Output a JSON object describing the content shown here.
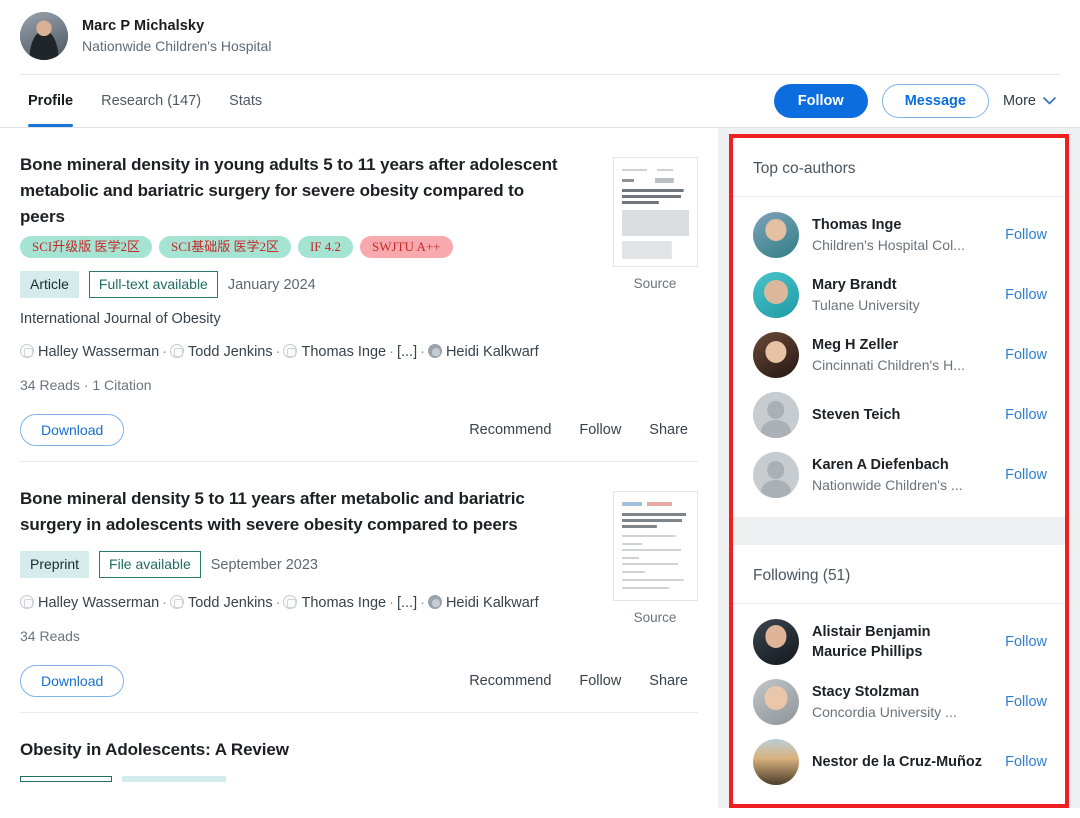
{
  "profile": {
    "name": "Marc P Michalsky",
    "affiliation": "Nationwide Children's Hospital",
    "avatar_icon": "user-photo"
  },
  "nav": {
    "tabs": [
      {
        "label": "Profile",
        "active": true
      },
      {
        "label": "Research (147)",
        "active": false
      },
      {
        "label": "Stats",
        "active": false
      }
    ],
    "follow_label": "Follow",
    "message_label": "Message",
    "more_label": "More",
    "more_icon": "chevron-down-icon"
  },
  "publications": [
    {
      "title": "Bone mineral density in young adults 5 to 11 years after adolescent metabolic and bariatric surgery for severe obesity compared to peers",
      "sci_badges": [
        {
          "text": "SCI升级版 医学2区",
          "style": "mint"
        },
        {
          "text": "SCI基础版 医学2区",
          "style": "mint"
        },
        {
          "text": "IF 4.2",
          "style": "mint"
        },
        {
          "text": "SWJTU A++",
          "style": "pink"
        }
      ],
      "type": "Article",
      "availability": "Full-text available",
      "date": "January 2024",
      "journal": "International Journal of Obesity",
      "authors": [
        "Halley Wasserman",
        "Todd Jenkins",
        "Thomas Inge",
        "[...]",
        "Heidi Kalkwarf"
      ],
      "stats": "34 Reads · 1 Citation",
      "download_label": "Download",
      "actions": [
        "Recommend",
        "Follow",
        "Share"
      ],
      "thumb_label": "Source"
    },
    {
      "title": "Bone mineral density 5 to 11 years after metabolic and bariatric surgery in adolescents with severe obesity compared to peers",
      "sci_badges": [],
      "type": "Preprint",
      "availability": "File available",
      "date": "September 2023",
      "journal": "",
      "authors": [
        "Halley Wasserman",
        "Todd Jenkins",
        "Thomas Inge",
        "[...]",
        "Heidi Kalkwarf"
      ],
      "stats": "34 Reads",
      "download_label": "Download",
      "actions": [
        "Recommend",
        "Follow",
        "Share"
      ],
      "thumb_label": "Source"
    },
    {
      "title": "Obesity in Adolescents: A Review",
      "sci_badges": [],
      "type": "",
      "availability": "",
      "date": "",
      "journal": "",
      "authors": [],
      "stats": "",
      "download_label": "",
      "actions": [],
      "thumb_label": ""
    }
  ],
  "sidebar": {
    "coauthors": {
      "title": "Top co-authors",
      "people": [
        {
          "name": "Thomas Inge",
          "affiliation": "Children's Hospital Col...",
          "follow": "Follow",
          "avatar": "p-inge"
        },
        {
          "name": "Mary Brandt",
          "affiliation": "Tulane University",
          "follow": "Follow",
          "avatar": "p-brandt"
        },
        {
          "name": "Meg H Zeller",
          "affiliation": "Cincinnati Children's H...",
          "follow": "Follow",
          "avatar": "p-zeller"
        },
        {
          "name": "Steven Teich",
          "affiliation": "",
          "follow": "Follow",
          "avatar": "placeholder"
        },
        {
          "name": "Karen A Diefenbach",
          "affiliation": "Nationwide Children's ...",
          "follow": "Follow",
          "avatar": "placeholder"
        }
      ]
    },
    "following": {
      "title": "Following (51)",
      "people": [
        {
          "name": "Alistair Benjamin Maurice Phillips",
          "affiliation": "",
          "follow": "Follow",
          "avatar": "p-phillips"
        },
        {
          "name": "Stacy Stolzman",
          "affiliation": "Concordia University ...",
          "follow": "Follow",
          "avatar": "p-stolzman"
        },
        {
          "name": "Nestor de la Cruz-Muñoz",
          "affiliation": "",
          "follow": "Follow",
          "avatar": "p-cruz"
        }
      ]
    },
    "highlight_color": "#f02020"
  }
}
